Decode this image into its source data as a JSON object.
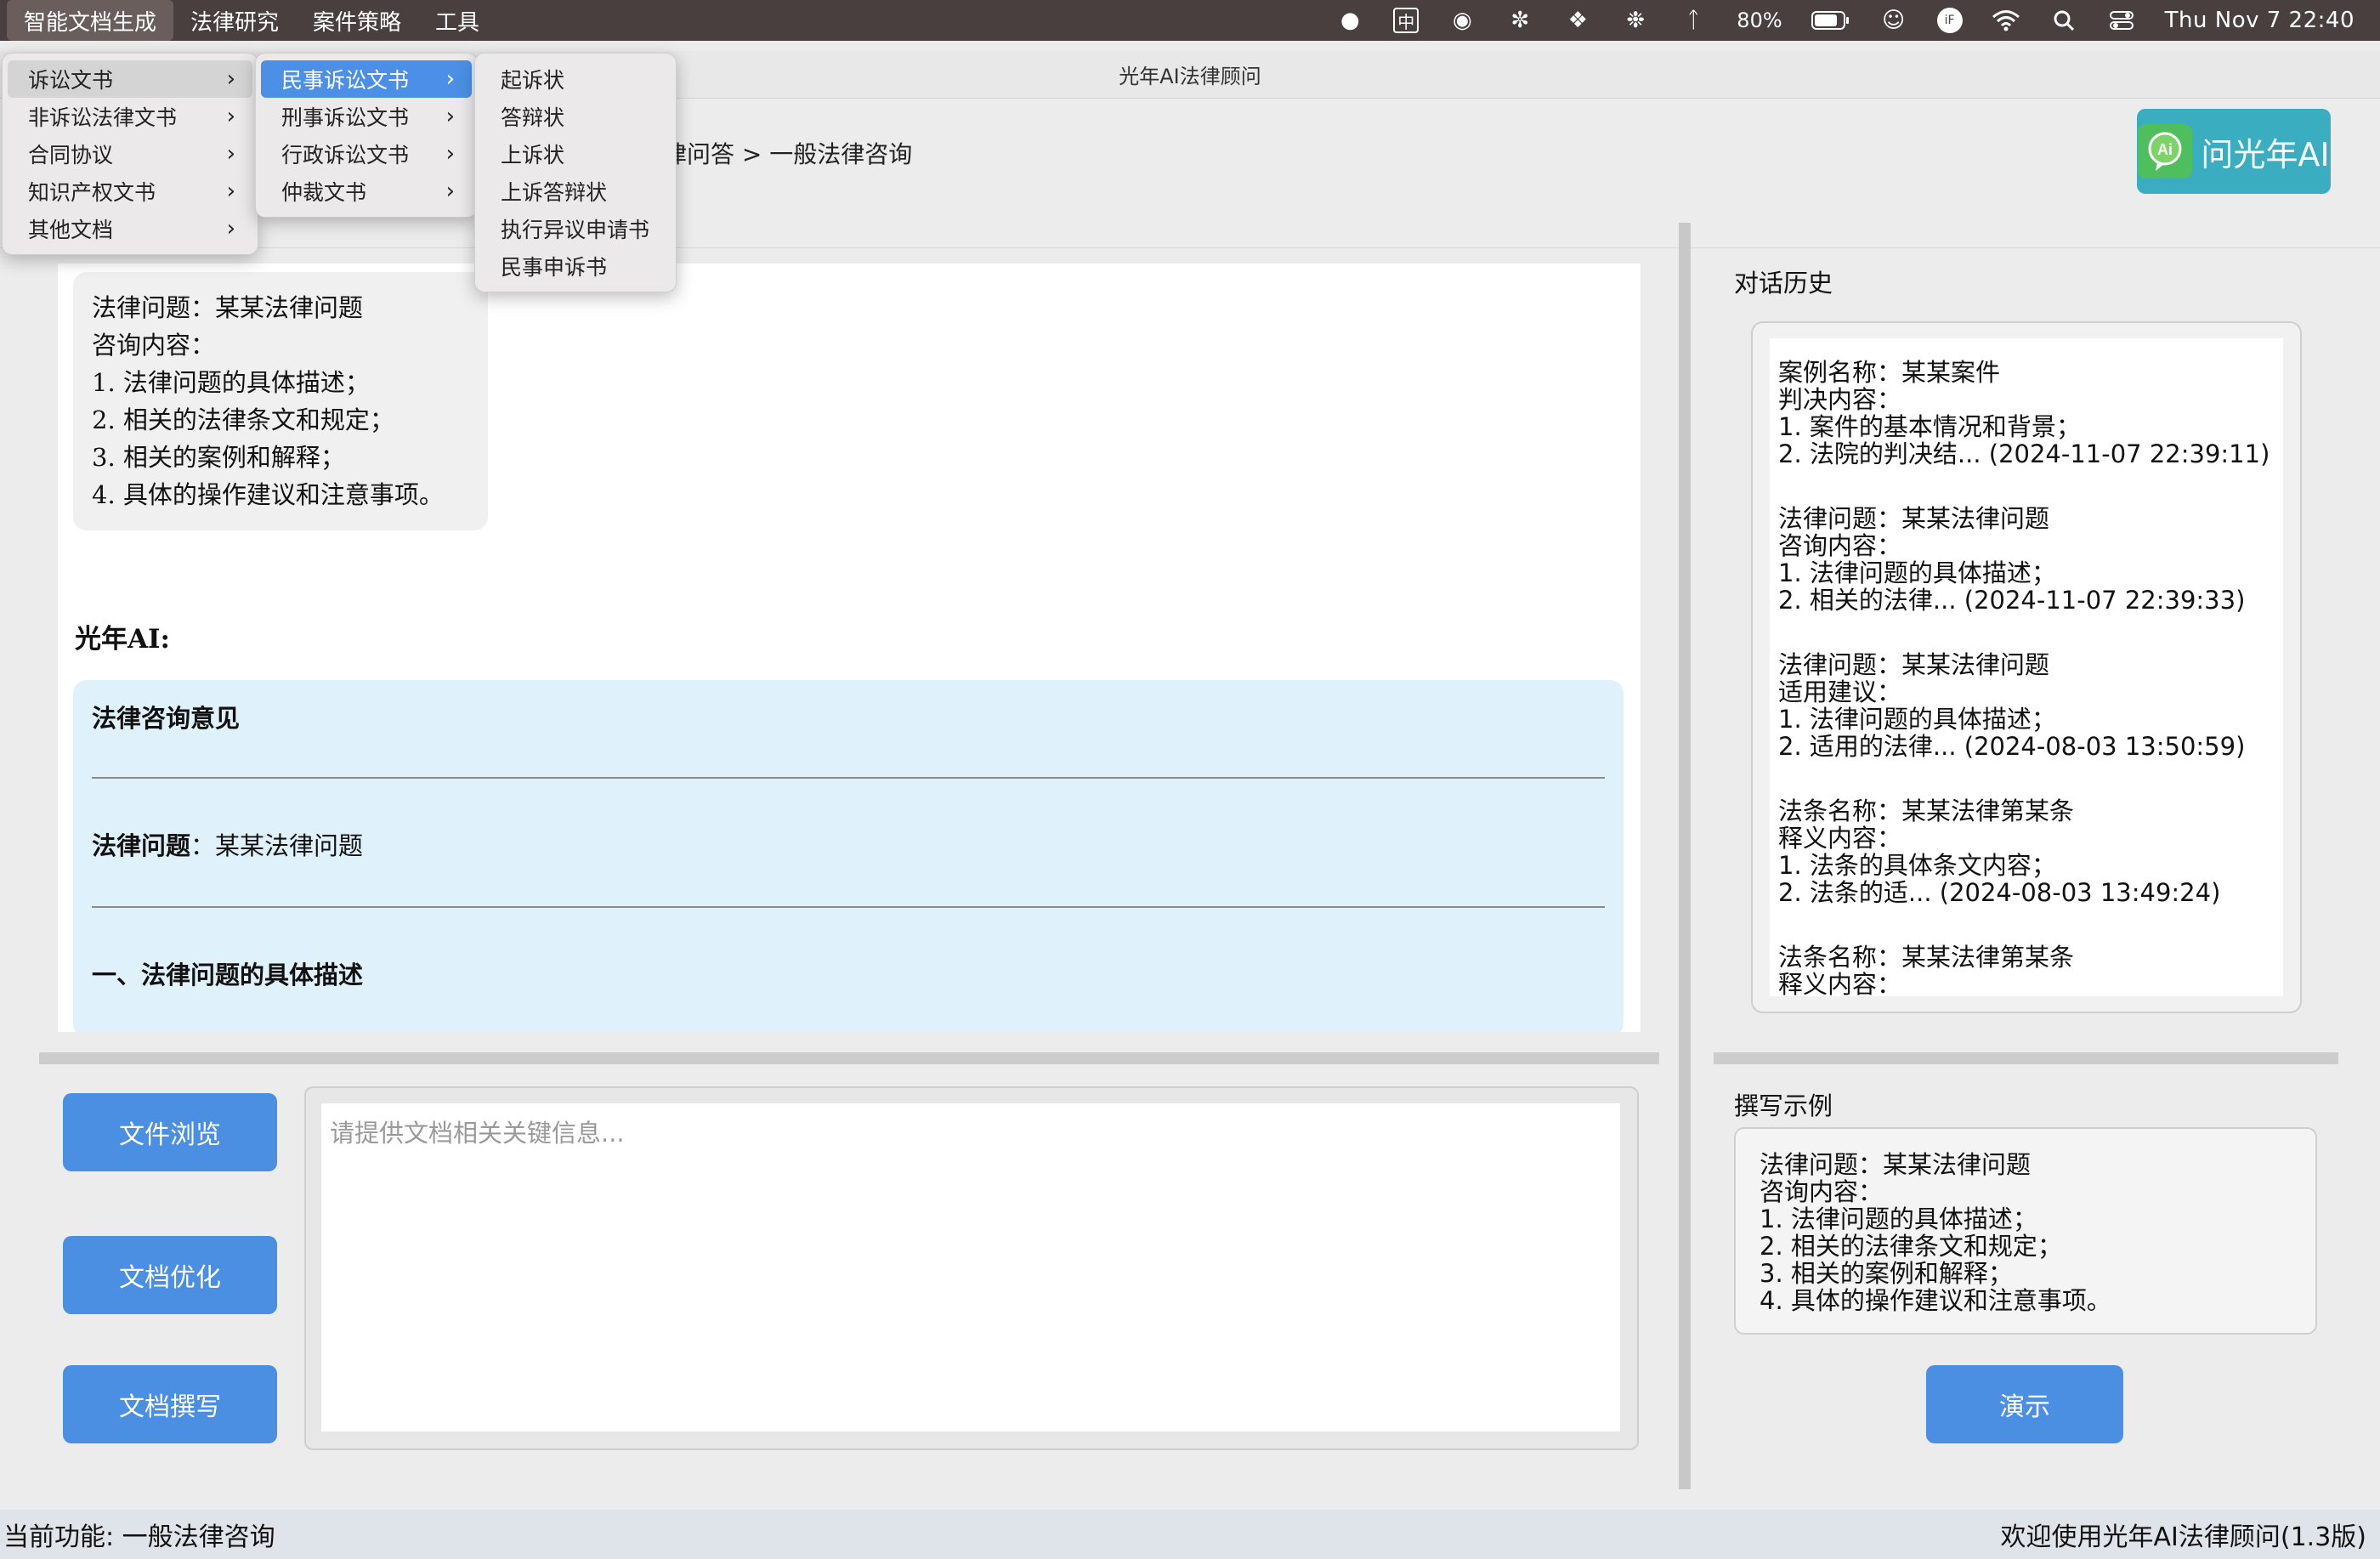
{
  "menubar": {
    "items": [
      "智能文档生成",
      "法律研究",
      "案件策略",
      "工具"
    ],
    "battery": "80%",
    "ime": "中",
    "clock": "Thu Nov 7  22:40"
  },
  "window": {
    "title": "光年AI法律顾问",
    "breadcrumb": "律问答 > 一般法律咨询",
    "ask_button": "问光年AI"
  },
  "menus": {
    "level1": [
      "诉讼文书",
      "非诉讼法律文书",
      "合同协议",
      "知识产权文书",
      "其他文档"
    ],
    "level2": [
      "民事诉讼文书",
      "刑事诉讼文书",
      "行政诉讼文书",
      "仲裁文书"
    ],
    "level3": [
      "起诉状",
      "答辩状",
      "上诉状",
      "上诉答辩状",
      "执行异议申请书",
      "民事申诉书"
    ]
  },
  "chat": {
    "user_lines": [
      "法律问题：某某法律问题",
      "咨询内容：",
      "1. 法律问题的具体描述；",
      "2. 相关的法律条文和规定；",
      "3. 相关的案例和解释；",
      "4. 具体的操作建议和注意事项。"
    ],
    "ai_label": "光年AI:",
    "ai_title": "法律咨询意见",
    "ai_issue_label": "法律问题",
    "ai_issue_value": "：某某法律问题",
    "ai_section1": "一、法律问题的具体描述"
  },
  "buttons": {
    "browse": "文件浏览",
    "optimize": "文档优化",
    "write": "文档撰写",
    "demo": "演示"
  },
  "input": {
    "placeholder": "请提供文档相关关键信息..."
  },
  "history": {
    "title": "对话历史",
    "entries": [
      "案例名称：某某案件\n判决内容：\n1. 案件的基本情况和背景；\n2. 法院的判决结... (2024-11-07 22:39:11)",
      "法律问题：某某法律问题\n咨询内容：\n1. 法律问题的具体描述；\n2. 相关的法律... (2024-11-07 22:39:33)",
      "法律问题：某某法律问题\n适用建议：\n1. 法律问题的具体描述；\n2. 适用的法律... (2024-08-03 13:50:59)",
      "法条名称：某某法律第某条\n释义内容：\n1. 法条的具体条文内容；\n2. 法条的适... (2024-08-03 13:49:24)",
      "法条名称：某某法律第某条\n释义内容："
    ]
  },
  "example": {
    "title": "撰写示例",
    "text": "法律问题：某某法律问题\n咨询内容：\n1. 法律问题的具体描述；\n2. 相关的法律条文和规定；\n3. 相关的案例和解释；\n4. 具体的操作建议和注意事项。"
  },
  "status": {
    "left": "当前功能: 一般法律咨询",
    "right": "欢迎使用光年AI法律顾问(1.3版)"
  }
}
